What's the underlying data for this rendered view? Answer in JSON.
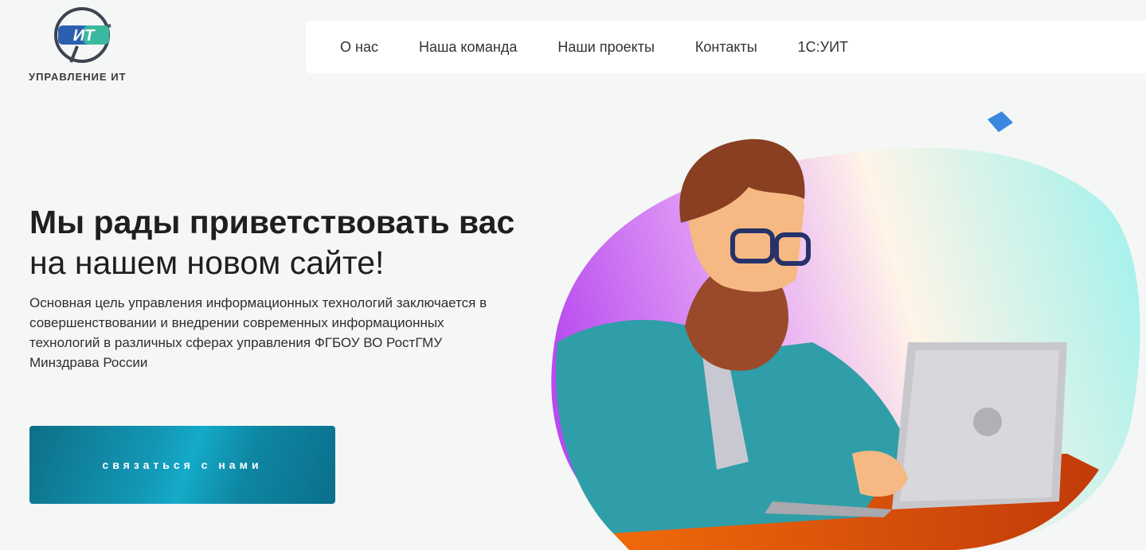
{
  "brand": {
    "name": "УПРАВЛЕНИЕ ИТ",
    "logo_letters": "ИТ"
  },
  "nav": {
    "items": [
      "О нас",
      "Наша команда",
      "Наши проекты",
      "Контакты",
      "1С:УИТ"
    ]
  },
  "hero": {
    "title_line1": "Мы рады приветствовать вас",
    "title_line2": "на нашем новом сайте!",
    "description": "Основная цель управления информационных технологий заключается в совершенствовании и внедрении современных информационных технологий в различных сферах управления ФГБОУ ВО РостГМУ Минздрава России",
    "cta_label": "связаться с нами"
  },
  "illustration": {
    "subject": "man-with-laptop-illustration"
  },
  "colors": {
    "accent": "#0e86a2",
    "background": "#f4f7f6",
    "nav_bg": "#ffffff"
  }
}
